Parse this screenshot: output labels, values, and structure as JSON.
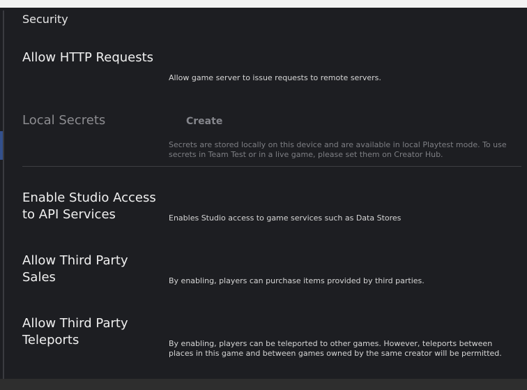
{
  "section": {
    "title": "Security"
  },
  "rows": [
    {
      "label": "Allow HTTP Requests",
      "description": "Allow game server to issue requests to remote servers."
    },
    {
      "label": "Local Secrets",
      "button": "Create",
      "description": "Secrets are stored locally on this device and are available in local Playtest mode. To use secrets in Team Test or in a live game, please set them on Creator Hub."
    },
    {
      "label": "Enable Studio Access to API Services",
      "description": "Enables Studio access to game services such as Data Stores"
    },
    {
      "label": "Allow Third Party Sales",
      "description": "By enabling, players can purchase items provided by third parties."
    },
    {
      "label": "Allow Third Party Teleports",
      "description": "By enabling, players can be teleported to other games. However, teleports between places in this game and between games owned by the same creator will be permitted."
    }
  ]
}
